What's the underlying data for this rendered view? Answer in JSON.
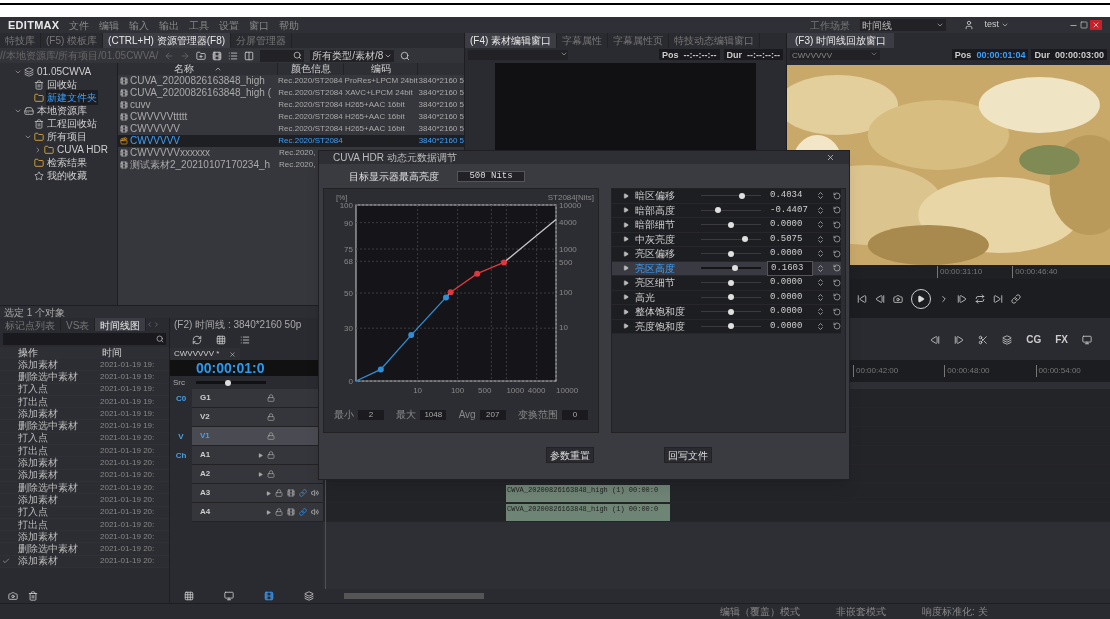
{
  "app": {
    "logo": "EDITMAX",
    "menu": [
      "文件",
      "编辑",
      "输入",
      "输出",
      "工具",
      "设置",
      "窗口",
      "帮助"
    ],
    "scene_label": "工作场景",
    "scene_value": "时间线",
    "user": "test"
  },
  "resource_panel": {
    "tabs": [
      {
        "label": "特技库",
        "selected": false
      },
      {
        "label": "(F5) 模板库",
        "selected": false
      },
      {
        "label": "(CTRL+H) 资源管理器(F8)",
        "selected": true
      },
      {
        "label": "分屏管理器",
        "selected": false
      }
    ],
    "path": "//本地资源库/所有项目/01.05CWVA/",
    "filter": "所有类型/素材/8",
    "tree": [
      {
        "label": "01.05CWVA",
        "kind": "project",
        "expanded": true,
        "selected": false,
        "children": [
          {
            "label": "回收站",
            "kind": "trash",
            "selected": false
          },
          {
            "label": "新建文件夹",
            "kind": "folder",
            "selected": true
          }
        ]
      },
      {
        "label": "本地资源库",
        "kind": "drive",
        "expanded": true,
        "selected": false,
        "children": [
          {
            "label": "工程回收站",
            "kind": "trash",
            "selected": false
          },
          {
            "label": "所有项目",
            "kind": "folder",
            "expanded": true,
            "selected": false,
            "children": [
              {
                "label": "CUVA HDR",
                "kind": "folder",
                "expanded": false,
                "selected": false
              }
            ]
          },
          {
            "label": "检索结果",
            "kind": "folder",
            "selected": false
          },
          {
            "label": "我的收藏",
            "kind": "star",
            "selected": false
          }
        ]
      }
    ],
    "table": {
      "columns": [
        "名称",
        "颜色信息",
        "编码"
      ],
      "rows": [
        {
          "kind": "clip",
          "name": "CUVA_20200826163848_high",
          "color_info": "Rec.2020/ST2084",
          "codec": "ProRes+LPCM 24bit",
          "column_4": "3840*2160 5",
          "selected": false
        },
        {
          "kind": "clip",
          "name": "CUVA_20200826163848_high (",
          "color_info": "Rec.2020/ST2084",
          "codec": "XAVC+LPCM 24bit",
          "column_4": "3840*2160 5",
          "selected": false
        },
        {
          "kind": "clip",
          "name": "cuvv",
          "color_info": "Rec.2020/ST2084",
          "codec": "H265+AAC 16bit",
          "column_4": "3840*2160 5",
          "selected": false
        },
        {
          "kind": "clip",
          "name": "CWVVVVttttt",
          "color_info": "Rec.2020/ST2084",
          "codec": "H265+AAC 16bit",
          "column_4": "3840*2160 5",
          "selected": false
        },
        {
          "kind": "clip",
          "name": "CWVVVVV",
          "color_info": "Rec.2020/ST2084",
          "codec": "H265+AAC 16bit",
          "column_4": "3840*2160 5",
          "selected": false
        },
        {
          "kind": "sequence",
          "name": "CWVVVVV",
          "color_info": "Rec.2020/ST2084",
          "column_4": "3840*2160 5",
          "selected": true
        },
        {
          "kind": "clip",
          "name": "CWVVVVVxxxxxx",
          "color_info": "Rec.2020,",
          "selected": false
        },
        {
          "kind": "clip",
          "name": "测试素材2_20210107170234_h",
          "color_info": "Rec.2020,",
          "selected": false
        }
      ]
    },
    "status": "选定 1 个对象"
  },
  "source_monitor": {
    "tabs": [
      {
        "label": "(F4) 素材编辑窗口",
        "selected": true
      },
      {
        "label": "字幕属性",
        "selected": false
      },
      {
        "label": "字幕属性页",
        "selected": false
      },
      {
        "label": "特技动态编辑窗口",
        "selected": false
      }
    ],
    "pos_label": "Pos",
    "pos": "--:--:--:--",
    "dur_label": "Dur",
    "dur": "--:--:--:--"
  },
  "timeline_monitor": {
    "tab": "(F3) 时间线回放窗口",
    "clip": "CWVVVVV",
    "pos_label": "Pos",
    "pos": "00:00:01:04",
    "dur_label": "Dur",
    "dur": "00:00:03:00",
    "ruler": [
      "00:00:31:10",
      "00:00:46:40"
    ]
  },
  "history": {
    "tabs": [
      {
        "label": "标记点列表",
        "selected": false
      },
      {
        "label": "VS表",
        "selected": false
      },
      {
        "label": "时间线图",
        "selected": true
      }
    ],
    "columns": [
      "操作",
      "时间"
    ],
    "rows": [
      {
        "action": "添加素材",
        "time": "2021-01-19 19:",
        "checked": false
      },
      {
        "action": "删除选中素材",
        "time": "2021-01-19 19:",
        "checked": false
      },
      {
        "action": "打入点",
        "time": "2021-01-19 19:",
        "checked": false
      },
      {
        "action": "打出点",
        "time": "2021-01-19 19:",
        "checked": false
      },
      {
        "action": "添加素材",
        "time": "2021-01-19 19:",
        "checked": false
      },
      {
        "action": "删除选中素材",
        "time": "2021-01-19 19:",
        "checked": false
      },
      {
        "action": "打入点",
        "time": "2021-01-19 20:",
        "checked": false
      },
      {
        "action": "打出点",
        "time": "2021-01-19 20:",
        "checked": false
      },
      {
        "action": "添加素材",
        "time": "2021-01-19 20:",
        "checked": false
      },
      {
        "action": "添加素材",
        "time": "2021-01-19 20:",
        "checked": false
      },
      {
        "action": "删除选中素材",
        "time": "2021-01-19 20:",
        "checked": false
      },
      {
        "action": "添加素材",
        "time": "2021-01-19 20:",
        "checked": false
      },
      {
        "action": "打入点",
        "time": "2021-01-19 20:",
        "checked": false
      },
      {
        "action": "打出点",
        "time": "2021-01-19 20:",
        "checked": false
      },
      {
        "action": "添加素材",
        "time": "2021-01-19 20:",
        "checked": false
      },
      {
        "action": "删除选中素材",
        "time": "2021-01-19 20:",
        "checked": false
      },
      {
        "action": "添加素材",
        "time": "2021-01-19 20:",
        "checked": true
      }
    ]
  },
  "timeline": {
    "title": "(F2) 时间线 : 3840*2160 50p",
    "tab": "CWVVVVV *",
    "timecode": "00:00:01:0",
    "src": "Src",
    "zoom": {
      "level": 0.45
    },
    "edit_tools": [
      "CG",
      "FX"
    ],
    "ruler": [
      "00:00:42:00",
      "00:00:48:00",
      "00:00:54:00"
    ],
    "tracks": [
      {
        "group": "C0",
        "name": "G1",
        "kind": "video",
        "selected": false
      },
      {
        "name": "V2",
        "kind": "video",
        "selected": false
      },
      {
        "group": "V",
        "name": "V1",
        "kind": "video",
        "selected": true
      },
      {
        "group": "Ch",
        "name": "A1",
        "kind": "audio",
        "selected": false
      },
      {
        "name": "A2",
        "kind": "audio",
        "selected": false
      },
      {
        "name": "A3",
        "kind": "audio_full",
        "selected": false,
        "clip": "CWVA_20200826163848_high (1) 00:00:0"
      },
      {
        "name": "A4",
        "kind": "audio_full",
        "selected": false,
        "clip": "CWVA_20200826163848_high (1) 00:00:0"
      }
    ]
  },
  "dialog": {
    "title": "CUVA HDR 动态元数据调节",
    "target_label": "目标显示器最高亮度",
    "target_value": "500 Nits",
    "curve_plot": {
      "left_label": "[%]",
      "right_label": "ST2084[Nits]",
      "left_ticks": [
        "100",
        "90",
        "75",
        "68",
        "50",
        "30",
        "0"
      ],
      "right_ticks": [
        "10000",
        "4000",
        "1000",
        "500",
        "100",
        "10"
      ],
      "bottom_ticks": [
        "10",
        "100",
        "500",
        "1000",
        "4000",
        "10000"
      ]
    },
    "stats": [
      {
        "label": "最小",
        "value": "2"
      },
      {
        "label": "最大",
        "value": "1048"
      },
      {
        "label": "Avg",
        "value": "207"
      },
      {
        "label": "变换范围",
        "value": "0"
      }
    ],
    "params": [
      {
        "label": "暗区偏移",
        "value": "0.4034",
        "level": 0.69,
        "selected": false
      },
      {
        "label": "暗部高度",
        "value": "-0.4407",
        "level": 0.28,
        "selected": false
      },
      {
        "label": "暗部细节",
        "value": "0.0000",
        "level": 0.5,
        "selected": false
      },
      {
        "label": "中灰亮度",
        "value": "0.5075",
        "level": 0.74,
        "selected": false
      },
      {
        "label": "亮区偏移",
        "value": "0.0000",
        "level": 0.5,
        "selected": false
      },
      {
        "label": "亮区高度",
        "value": "0.1603",
        "level": 0.57,
        "selected": true
      },
      {
        "label": "亮区细节",
        "value": "0.0000",
        "level": 0.5,
        "selected": false
      },
      {
        "label": "高光",
        "value": "0.0000",
        "level": 0.5,
        "selected": false
      },
      {
        "label": "整体饱和度",
        "value": "0.0000",
        "level": 0.5,
        "selected": false
      },
      {
        "label": "亮度饱和度",
        "value": "0.0000",
        "level": 0.5,
        "selected": false
      }
    ],
    "buttons": [
      "参数重置",
      "回写文件"
    ]
  },
  "status_bar": [
    "编辑（覆盖）模式",
    "非嵌套模式",
    "响度标准化: 关"
  ]
}
